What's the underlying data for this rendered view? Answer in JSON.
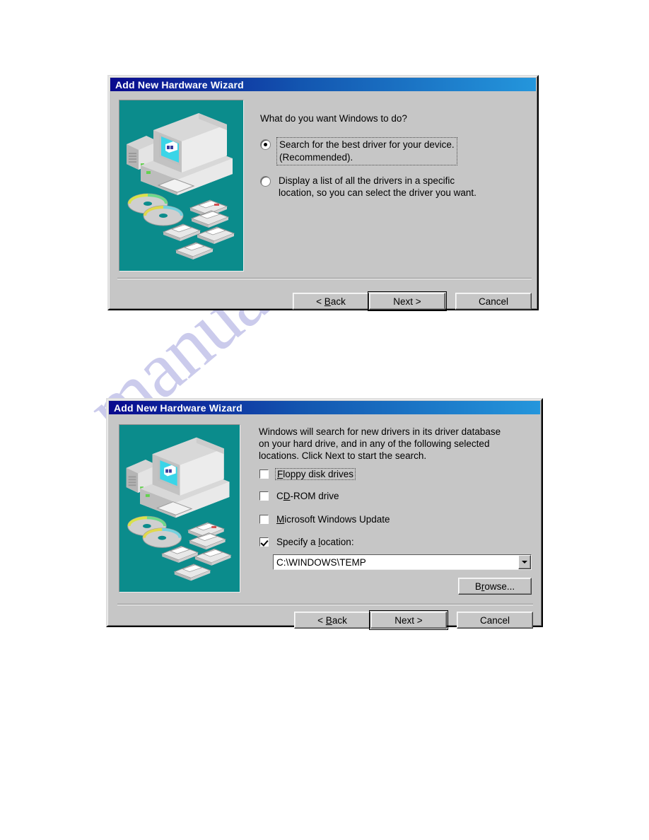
{
  "page": {
    "watermark": "manualslive.com"
  },
  "dialog1": {
    "title": "Add New Hardware Wizard",
    "prompt": "What do you want Windows to do?",
    "options": [
      {
        "id": "search-best-driver",
        "label": "Search for the best driver for your device.\n(Recommended).",
        "selected": true,
        "focused": true
      },
      {
        "id": "display-driver-list",
        "label": "Display a list of all the drivers in a specific\nlocation, so you can select the driver you want.",
        "selected": false,
        "focused": false
      }
    ],
    "buttons": {
      "back": "< Back",
      "back_pre": "< ",
      "back_accel": "B",
      "back_post": "ack",
      "next": "Next >",
      "cancel": "Cancel"
    },
    "illustration": {
      "name": "computer-media-illustration",
      "background": "#0b8c8c",
      "screen_color": "#3ad5e8"
    }
  },
  "dialog2": {
    "title": "Add New Hardware Wizard",
    "prompt": "Windows will search for new drivers in its driver database on your hard drive, and in any of the following selected locations. Click Next to start the search.",
    "prompt_lines": [
      "Windows will search for new drivers in its driver database",
      "on your hard drive, and in any of the following selected",
      "locations. Click Next to start the search."
    ],
    "checkboxes": [
      {
        "id": "floppy-disk-drives",
        "accel": "F",
        "rest": "loppy disk drives",
        "checked": false,
        "focused": true
      },
      {
        "id": "cd-rom-drive",
        "pre": "C",
        "accel": "D",
        "rest": "-ROM drive",
        "checked": false,
        "focused": false
      },
      {
        "id": "microsoft-windows-update",
        "accel": "M",
        "rest": "icrosoft Windows Update",
        "checked": false,
        "focused": false
      },
      {
        "id": "specify-a-location",
        "pre": "Specify a ",
        "accel": "l",
        "rest": "ocation:",
        "checked": true,
        "focused": false
      }
    ],
    "location": {
      "value": "C:\\WINDOWS\\TEMP",
      "browse_pre": "B",
      "browse_accel": "r",
      "browse_post": "owse..."
    },
    "buttons": {
      "back": "< Back",
      "next": "Next >",
      "cancel": "Cancel"
    },
    "illustration": {
      "name": "computer-media-illustration",
      "background": "#0b8c8c",
      "screen_color": "#3ad5e8"
    }
  }
}
